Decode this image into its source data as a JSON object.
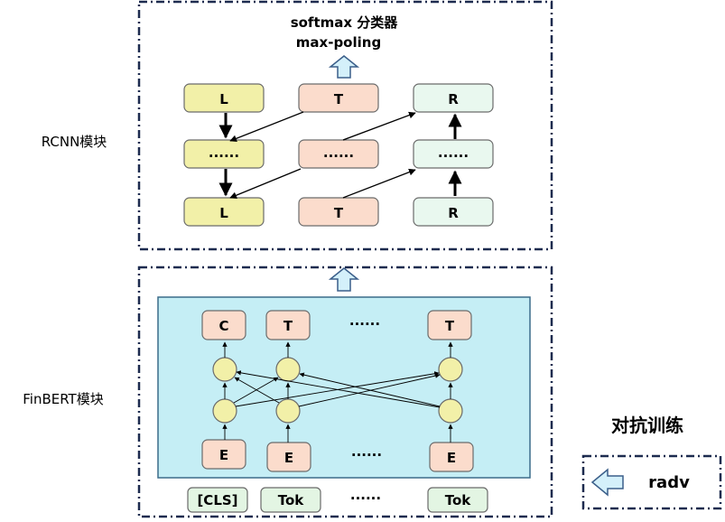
{
  "rcnn": {
    "label": "RCNN模块",
    "output_line1": "softmax 分类器",
    "output_line2": "max-poling",
    "row1": {
      "left": "L",
      "mid": "T",
      "right": "R"
    },
    "row2": {
      "left": "......",
      "mid": "......",
      "right": "......"
    },
    "row3": {
      "left": "L",
      "mid": "T",
      "right": "R"
    }
  },
  "finbert": {
    "label": "FinBERT模块",
    "outputs": {
      "c": "C",
      "t1": "T",
      "dots": "......",
      "t2": "T"
    },
    "embeds": {
      "e1": "E",
      "e2": "E",
      "dots": "......",
      "e3": "E"
    },
    "inputs": {
      "cls": "[CLS]",
      "tok1": "Tok",
      "dots": "......",
      "tok2": "Tok"
    }
  },
  "adversarial": {
    "title": "对抗训练",
    "radv": "radv"
  },
  "colors": {
    "yellow_fill": "#f2f0a8",
    "salmon_fill": "#fbdccc",
    "mint_fill": "#e9f8ef",
    "cyan_fill": "#c5eef5",
    "light_green_fill": "#e3f5e3",
    "arrow_fill": "#d4f0fa",
    "border": "#1d2b4f"
  }
}
